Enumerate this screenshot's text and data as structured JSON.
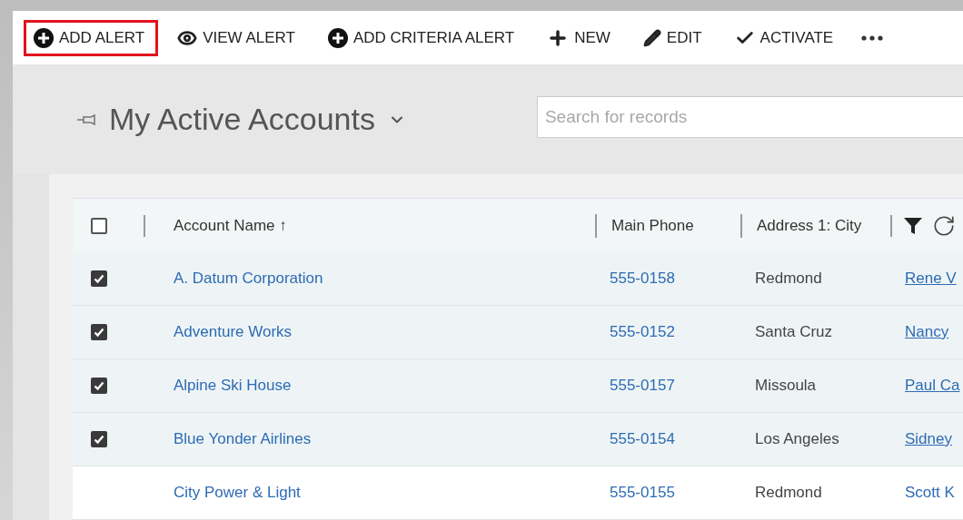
{
  "toolbar": {
    "items": [
      {
        "label": "ADD ALERT",
        "highlighted": true
      },
      {
        "label": "VIEW ALERT",
        "highlighted": false
      },
      {
        "label": "ADD CRITERIA ALERT",
        "highlighted": false
      },
      {
        "label": "NEW",
        "highlighted": false
      },
      {
        "label": "EDIT",
        "highlighted": false
      },
      {
        "label": "ACTIVATE",
        "highlighted": false
      }
    ]
  },
  "view": {
    "title": "My Active Accounts",
    "search": {
      "placeholder": "Search for records"
    }
  },
  "table": {
    "all_checked": false,
    "columns": [
      {
        "label": "Account Name ↑"
      },
      {
        "label": "Main Phone"
      },
      {
        "label": "Address 1: City"
      }
    ],
    "rows": [
      {
        "checked": true,
        "name": "A. Datum Corporation",
        "phone": "555-0158",
        "city": "Redmond",
        "contact": "Rene V",
        "contact_underlined": true
      },
      {
        "checked": true,
        "name": "Adventure Works",
        "phone": "555-0152",
        "city": "Santa Cruz",
        "contact": "Nancy",
        "contact_underlined": true
      },
      {
        "checked": true,
        "name": "Alpine Ski House",
        "phone": "555-0157",
        "city": "Missoula",
        "contact": "Paul Ca",
        "contact_underlined": true
      },
      {
        "checked": true,
        "name": "Blue Yonder Airlines",
        "phone": "555-0154",
        "city": "Los Angeles",
        "contact": "Sidney",
        "contact_underlined": true
      },
      {
        "checked": false,
        "name": "City Power & Light",
        "phone": "555-0155",
        "city": "Redmond",
        "contact": "Scott K",
        "contact_underlined": false
      }
    ]
  }
}
